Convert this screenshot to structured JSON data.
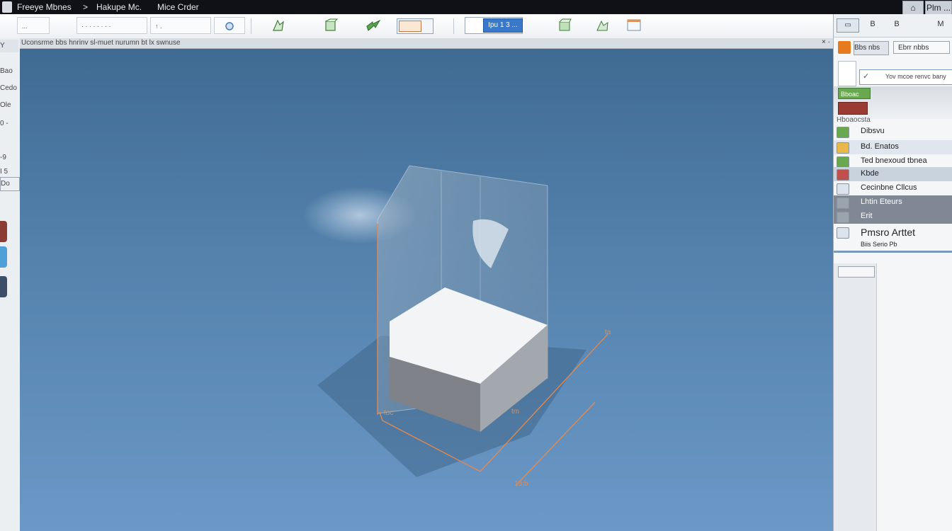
{
  "titlebar": {
    "items": [
      "Freeye Mbnes",
      "Hakupe Mc.",
      "Mice Crder"
    ],
    "separator": ">",
    "min_glyph": "⌂",
    "right_label": "Plm ..."
  },
  "toolbar": {
    "field1": "...",
    "field2": "· · · · · · · ·",
    "field3": "↑ .",
    "active_button": "Ipu 1 3 ..."
  },
  "viewport": {
    "header_text": "Uconsrme bbs hnrinv sl-muet nurumn bt lx swnuse",
    "close_glyph": "× ·",
    "dimension_labels": [
      "ta",
      "tm",
      "toc",
      "13:b"
    ]
  },
  "left_panel": {
    "tabs": [
      "Y",
      "Bao",
      "Cedo",
      "Ole",
      "0 -",
      "-9",
      "I 5",
      "Do"
    ]
  },
  "right_panel": {
    "top_buttons": [
      "▭",
      "B",
      "B",
      "M"
    ],
    "tabs": [
      "Bbs nbs",
      "Ebrr nbbs"
    ],
    "search_text": "Yov mcoe renvc bany",
    "group_label": "Bboac",
    "section_header": "Hboaocsta",
    "items": [
      {
        "label": "Dibsvu",
        "icon": "layer-icon",
        "color": "#6aa84f"
      },
      {
        "label": "Bd. Enatos",
        "icon": "folder-icon",
        "color": "#e8b84a"
      },
      {
        "label": "Ted bnexoud tbnea",
        "icon": "table-icon",
        "color": "#6aa84f"
      },
      {
        "label": "Kbde",
        "icon": "object-icon",
        "color": "#c0504d"
      },
      {
        "label": "Cecinbne Cllcus",
        "icon": "document-icon",
        "color": "#dbe4ee"
      },
      {
        "label": "Lhtin Eteurs",
        "icon": "gear-icon",
        "color": "#9aa4ae"
      },
      {
        "label": "Erit",
        "icon": "tool-icon",
        "color": "#9aa4ae"
      },
      {
        "label": "Pmsro Arttet",
        "icon": "text-icon",
        "color": "#dbe4ee"
      },
      {
        "label": "Biis Serio Pb",
        "icon": "small-icon",
        "color": "#dbe4ee"
      }
    ]
  },
  "colors": {
    "accent": "#3a78c9",
    "dimension": "#e8894a",
    "title_bg": "#0f1116",
    "viewport_top": "#3e6a91",
    "viewport_bottom": "#6b98c6"
  }
}
